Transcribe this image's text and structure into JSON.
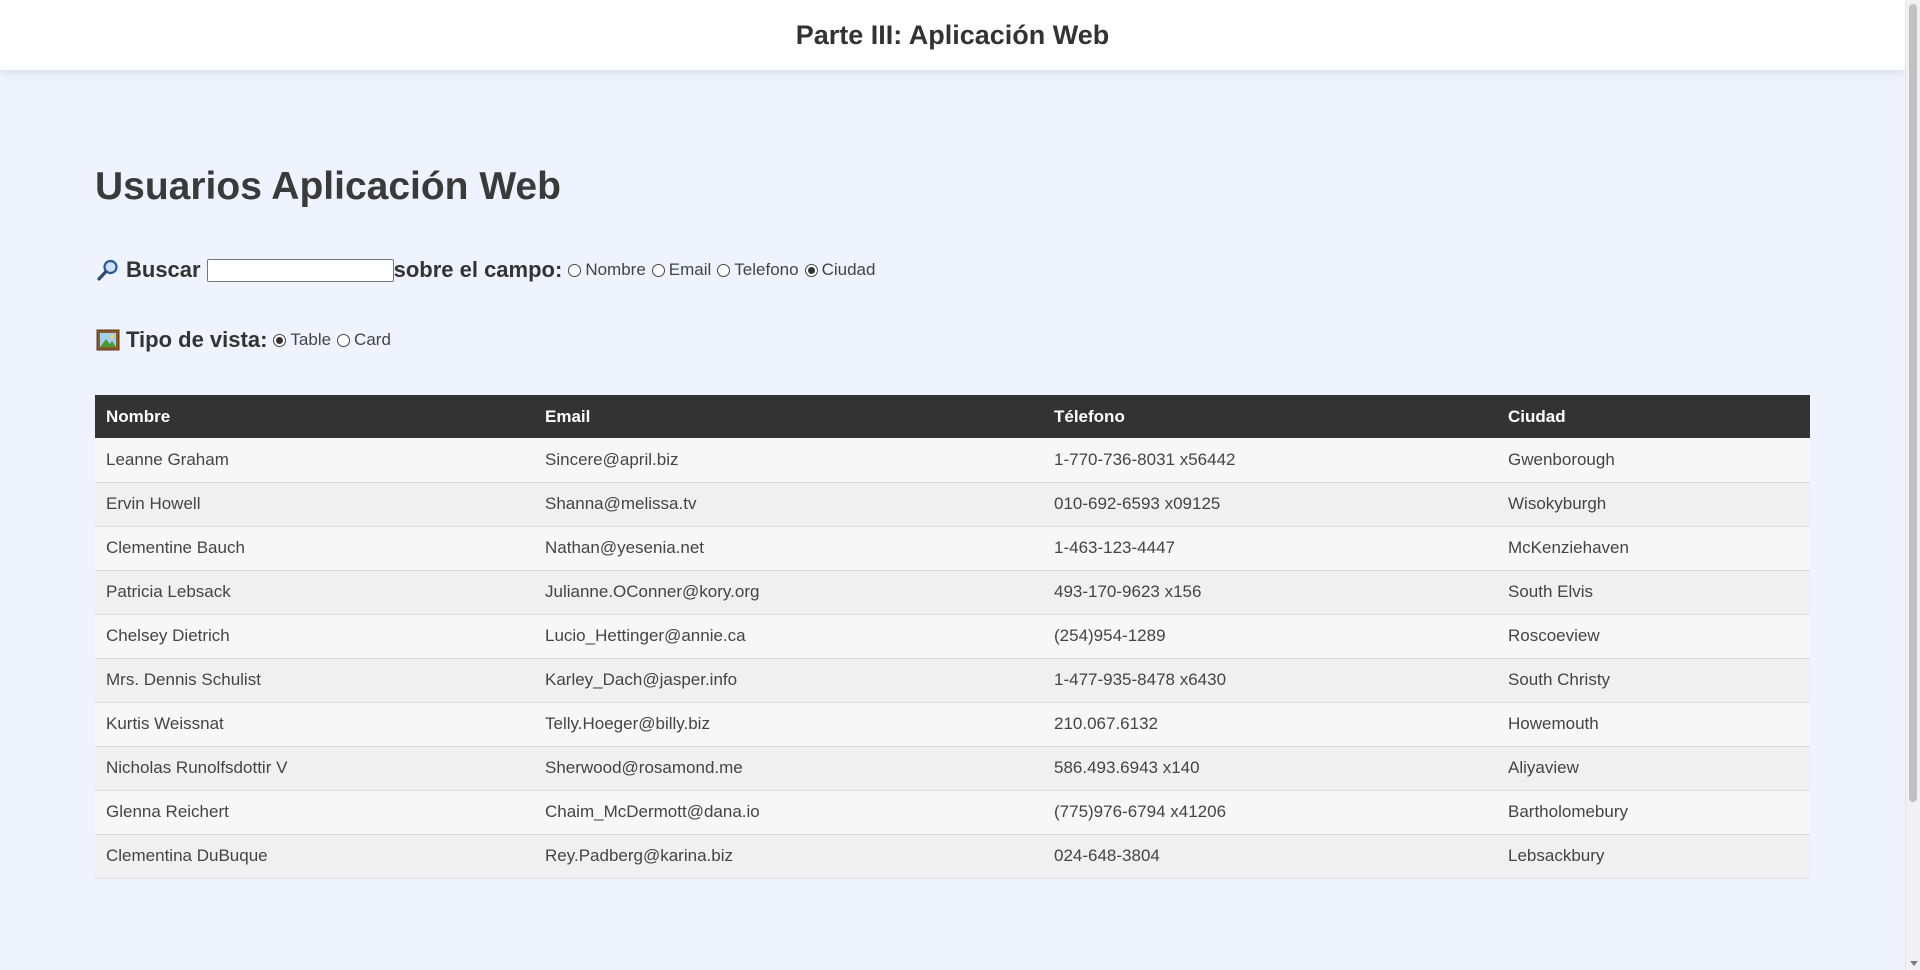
{
  "header": {
    "title": "Parte III: Aplicación Web"
  },
  "page": {
    "heading": "Usuarios Aplicación Web"
  },
  "search": {
    "icon": "magnifier-icon",
    "label": "Buscar",
    "value": "",
    "field_label": "sobre el campo:",
    "options": [
      {
        "label": "Nombre",
        "checked": false
      },
      {
        "label": "Email",
        "checked": false
      },
      {
        "label": "Telefono",
        "checked": false
      },
      {
        "label": "Ciudad",
        "checked": true
      }
    ]
  },
  "view": {
    "icon": "picture-icon",
    "label": "Tipo de vista:",
    "options": [
      {
        "label": "Table",
        "checked": true
      },
      {
        "label": "Card",
        "checked": false
      }
    ]
  },
  "table": {
    "columns": [
      "Nombre",
      "Email",
      "Télefono",
      "Ciudad"
    ],
    "rows": [
      [
        "Leanne Graham",
        "Sincere@april.biz",
        "1-770-736-8031 x56442",
        "Gwenborough"
      ],
      [
        "Ervin Howell",
        "Shanna@melissa.tv",
        "010-692-6593 x09125",
        "Wisokyburgh"
      ],
      [
        "Clementine Bauch",
        "Nathan@yesenia.net",
        "1-463-123-4447",
        "McKenziehaven"
      ],
      [
        "Patricia Lebsack",
        "Julianne.OConner@kory.org",
        "493-170-9623 x156",
        "South Elvis"
      ],
      [
        "Chelsey Dietrich",
        "Lucio_Hettinger@annie.ca",
        "(254)954-1289",
        "Roscoeview"
      ],
      [
        "Mrs. Dennis Schulist",
        "Karley_Dach@jasper.info",
        "1-477-935-8478 x6430",
        "South Christy"
      ],
      [
        "Kurtis Weissnat",
        "Telly.Hoeger@billy.biz",
        "210.067.6132",
        "Howemouth"
      ],
      [
        "Nicholas Runolfsdottir V",
        "Sherwood@rosamond.me",
        "586.493.6943 x140",
        "Aliyaview"
      ],
      [
        "Glenna Reichert",
        "Chaim_McDermott@dana.io",
        "(775)976-6794 x41206",
        "Bartholomebury"
      ],
      [
        "Clementina DuBuque",
        "Rey.Padberg@karina.biz",
        "024-648-3804",
        "Lebsackbury"
      ]
    ]
  }
}
